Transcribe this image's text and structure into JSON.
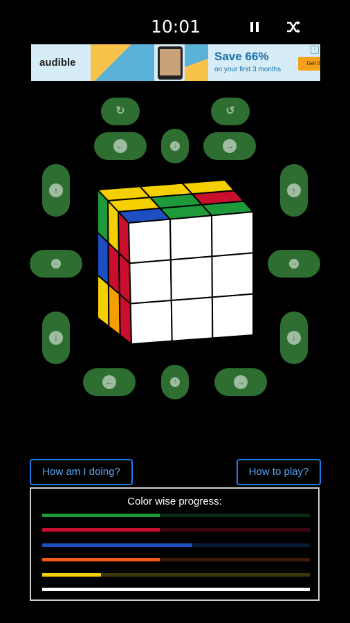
{
  "status_bar": {
    "time": "10:01",
    "pause_icon": "pause-icon",
    "shuffle_icon": "shuffle-icon"
  },
  "ad": {
    "brand": "audible",
    "headline": "Save 66%",
    "subtext": "on your first 3 months",
    "cta": "Get this deal",
    "info_icon": "ad-info-icon"
  },
  "controls": {
    "rotate_ccw_icon": "rotate-ccw-icon",
    "rotate_cw_icon": "rotate-cw-icon",
    "top_left_icon": "arrow-left-icon",
    "top_center_icon": "arrow-down-icon",
    "top_right_icon": "arrow-right-icon",
    "left_up_icon": "arrow-up-icon",
    "right_up_icon": "arrow-up-icon",
    "left_middle_icon": "arrow-left-icon",
    "right_middle_icon": "arrow-right-icon",
    "left_down_icon": "arrow-down-icon",
    "right_down_icon": "arrow-down-icon",
    "bottom_left_icon": "arrow-left-icon",
    "bottom_center_icon": "arrow-up-icon",
    "bottom_right_icon": "arrow-right-icon"
  },
  "cube": {
    "top": [
      [
        "#f5d000",
        "#f5d000",
        "#f5d000"
      ],
      [
        "#f5d000",
        "#1e9a3a",
        "#c8102e"
      ],
      [
        "#1e4fc0",
        "#1e9a3a",
        "#1e9a3a"
      ]
    ],
    "left": [
      [
        "#1e9a3a",
        "#f5d000",
        "#c8102e"
      ],
      [
        "#1e4fc0",
        "#c8102e",
        "#c8102e"
      ],
      [
        "#f5d000",
        "#f5a000",
        "#c8102e"
      ]
    ],
    "front": [
      [
        "#ffffff",
        "#ffffff",
        "#ffffff"
      ],
      [
        "#ffffff",
        "#ffffff",
        "#ffffff"
      ],
      [
        "#ffffff",
        "#ffffff",
        "#ffffff"
      ]
    ]
  },
  "buttons": {
    "how_am_i_doing": "How am I doing?",
    "how_to_play": "How to play?"
  },
  "progress": {
    "title": "Color wise progress:",
    "bars": [
      {
        "color": "#1e9a3a",
        "dim": "#0d2d12",
        "fraction": 0.44
      },
      {
        "color": "#c8102e",
        "dim": "#3a0710",
        "fraction": 0.44
      },
      {
        "color": "#1e4fc0",
        "dim": "#0a1838",
        "fraction": 0.56
      },
      {
        "color": "#f05a14",
        "dim": "#3d1a07",
        "fraction": 0.44
      },
      {
        "color": "#f5d000",
        "dim": "#3d3507",
        "fraction": 0.22
      },
      {
        "color": "#ffffff",
        "dim": "#444444",
        "fraction": 1.0
      }
    ]
  }
}
